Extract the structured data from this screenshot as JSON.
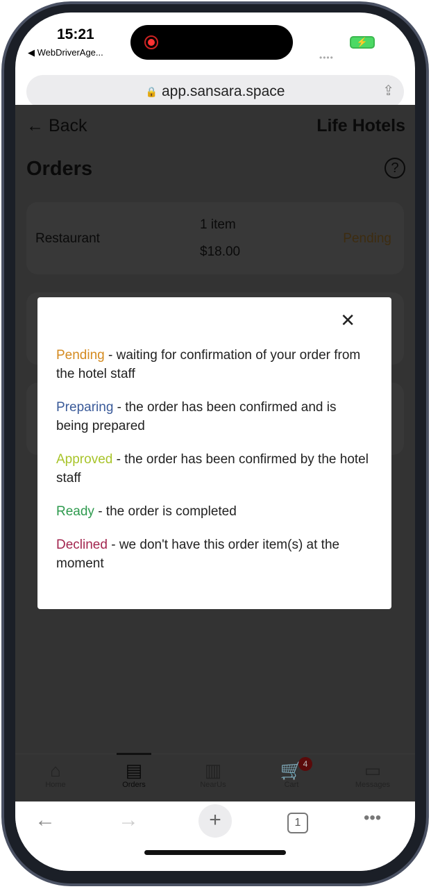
{
  "status": {
    "time": "15:21",
    "back_app": "◀ WebDriverAge...",
    "battery_icon": "battery-charging-icon"
  },
  "browser": {
    "url": "app.sansara.space",
    "tabs_count": "1"
  },
  "header": {
    "back_label": "Back",
    "hotel_name": "Life Hotels",
    "title": "Orders"
  },
  "orders": [
    {
      "venue": "Restaurant",
      "items": "1 item",
      "total": "$18.00",
      "status": "Pending"
    }
  ],
  "tabs": [
    {
      "label": "Home",
      "icon": "home-icon"
    },
    {
      "label": "Orders",
      "icon": "receipt-icon",
      "active": true
    },
    {
      "label": "NearUs",
      "icon": "map-icon"
    },
    {
      "label": "Cart",
      "icon": "cart-icon",
      "badge": "4"
    },
    {
      "label": "Messages",
      "icon": "message-icon"
    }
  ],
  "modal": {
    "statuses": [
      {
        "name": "Pending",
        "color": "#d48a1f",
        "desc": " - waiting for confirmation of your order from the hotel staff"
      },
      {
        "name": "Preparing",
        "color": "#3a5a99",
        "desc": " - the order has been confirmed and is being prepared"
      },
      {
        "name": "Approved",
        "color": "#a8c42a",
        "desc": " - the order has been confirmed by the hotel staff"
      },
      {
        "name": "Ready",
        "color": "#2e9a4e",
        "desc": " - the order is completed"
      },
      {
        "name": "Declined",
        "color": "#a3264f",
        "desc": " - we don't have this order item(s) at the moment"
      }
    ]
  }
}
